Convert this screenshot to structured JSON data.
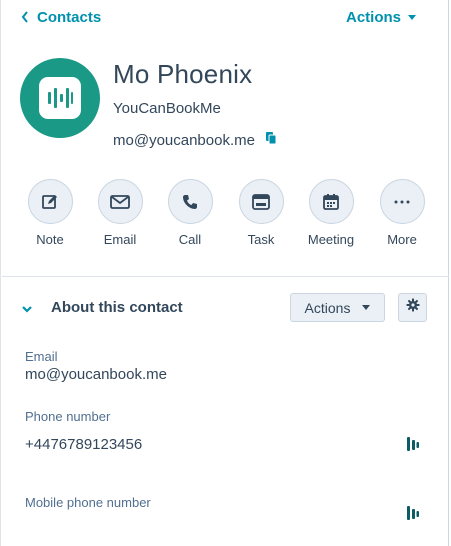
{
  "header": {
    "back_label": "Contacts",
    "actions_label": "Actions"
  },
  "contact": {
    "name": "Mo Phoenix",
    "company": "YouCanBookMe",
    "email": "mo@youcanbook.me"
  },
  "quick_actions": [
    {
      "label": "Note",
      "icon": "edit-icon"
    },
    {
      "label": "Email",
      "icon": "email-icon"
    },
    {
      "label": "Call",
      "icon": "phone-icon"
    },
    {
      "label": "Task",
      "icon": "task-icon"
    },
    {
      "label": "Meeting",
      "icon": "calendar-icon"
    },
    {
      "label": "More",
      "icon": "more-icon"
    }
  ],
  "about": {
    "title": "About this contact",
    "actions_label": "Actions",
    "fields": [
      {
        "label": "Email",
        "value": "mo@youcanbook.me"
      },
      {
        "label": "Phone number",
        "value": "+4476789123456"
      },
      {
        "label": "Mobile phone number",
        "value": ""
      }
    ]
  },
  "colors": {
    "accent": "#0091ae",
    "avatar_bg": "#1a9987",
    "text": "#33475b",
    "button_bg": "#eaf0f6"
  }
}
